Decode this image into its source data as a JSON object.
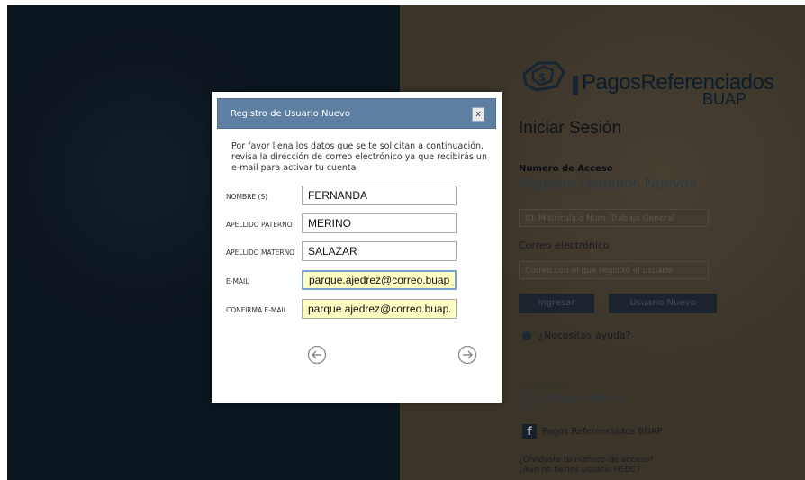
{
  "background": {
    "logo": {
      "title": "PagosReferenciados",
      "subtitle": "BUAP"
    },
    "login": {
      "title": "Iniciar Sesión",
      "access_label": "Numero de Acceso",
      "register_title": "Registro Usuarios Nuevos",
      "access_placeholder": "ID, Matrícula ó Num. Trabajo General",
      "email_label": "Correo electrónico",
      "email_placeholder": "Correo con el que registró el usuario",
      "login_button": "Ingresar",
      "new_user_button": "Usuario Nuevo",
      "help_link": "¿Necesitas ayuda?",
      "follow_label": "Síguenos!",
      "twitter_link": "@PagosRefBUAP",
      "facebook_link": "Pagos Referenciados BUAP",
      "forgot_lines": [
        "¿Olvidaste tu número de acceso?",
        "¿Aun no tienes usuario HSBC?"
      ]
    }
  },
  "modal": {
    "title": "Registro de Usuario Nuevo",
    "close_label": "x",
    "intro": "Por favor llena los datos que se te solicitan a continuación, revisa la dirección de correo electrónico ya que recibirás un e-mail para activar tu cuenta",
    "fields": [
      {
        "label": "Nombre (s)",
        "value": "FERNANDA"
      },
      {
        "label": "Apellido Paterno",
        "value": "MERINO"
      },
      {
        "label": "Apellido Materno",
        "value": "SALAZAR"
      },
      {
        "label": "E-mail",
        "value": "parque.ajedrez@correo.buap.mx"
      },
      {
        "label": "Confirma E-mail",
        "value": "parque.ajedrez@correo.buap.mx"
      }
    ]
  },
  "colors": {
    "modal_header": "#5d7fa2",
    "left_background": "#0d1822",
    "right_background": "#443c2f",
    "email_highlight": "#ffffc4"
  },
  "icons": [
    "logo-mark-icon",
    "close-icon",
    "prev-arrow-icon",
    "next-arrow-icon",
    "help-icon",
    "twitter-icon",
    "facebook-icon"
  ]
}
